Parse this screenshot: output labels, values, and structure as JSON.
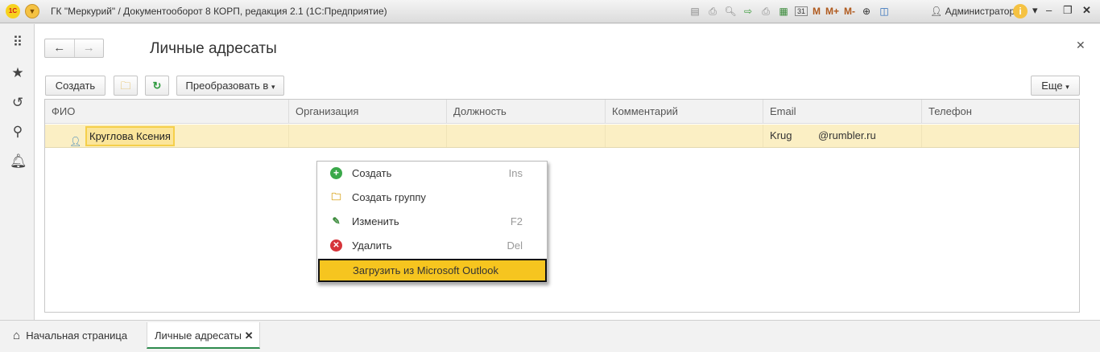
{
  "window": {
    "title": "ГК \"Меркурий\" / Документооборот 8 КОРП, редакция 2.1  (1С:Предприятие)",
    "logo": "1С",
    "user": "Администратор",
    "toolbar": {
      "m": "M",
      "m_plus": "M+",
      "m_minus": "M-"
    },
    "calendar_day": "31"
  },
  "sidebar": {
    "items": [
      "apps-grid-icon",
      "star-icon",
      "history-icon",
      "search-icon",
      "bell-icon"
    ]
  },
  "page": {
    "title": "Личные адресаты"
  },
  "toolbar": {
    "create": "Создать",
    "convert": "Преобразовать в",
    "more": "Еще"
  },
  "table": {
    "columns": [
      "ФИО",
      "Организация",
      "Должность",
      "Комментарий",
      "Email",
      "Телефон"
    ],
    "rows": [
      {
        "name": "Круглова Ксения",
        "organization": "",
        "position": "",
        "comment": "",
        "email": "Krug         @rumbler.ru",
        "phone": ""
      }
    ]
  },
  "context_menu": {
    "items": [
      {
        "label": "Создать",
        "shortcut": "Ins",
        "icon": "plus-circle-icon"
      },
      {
        "label": "Создать группу",
        "shortcut": "",
        "icon": "folder-add-icon"
      },
      {
        "label": "Изменить",
        "shortcut": "F2",
        "icon": "pencil-icon"
      },
      {
        "label": "Удалить",
        "shortcut": "Del",
        "icon": "delete-circle-icon"
      },
      {
        "label": "Загрузить из Microsoft Outlook",
        "shortcut": "",
        "icon": ""
      }
    ]
  },
  "tabs": [
    {
      "label": "Начальная страница"
    },
    {
      "label": "Личные адресаты",
      "active": true
    }
  ],
  "colors": {
    "accent": "#f6c51f",
    "row_selected": "#fbefc4",
    "active_tab": "#2e8b4e"
  }
}
